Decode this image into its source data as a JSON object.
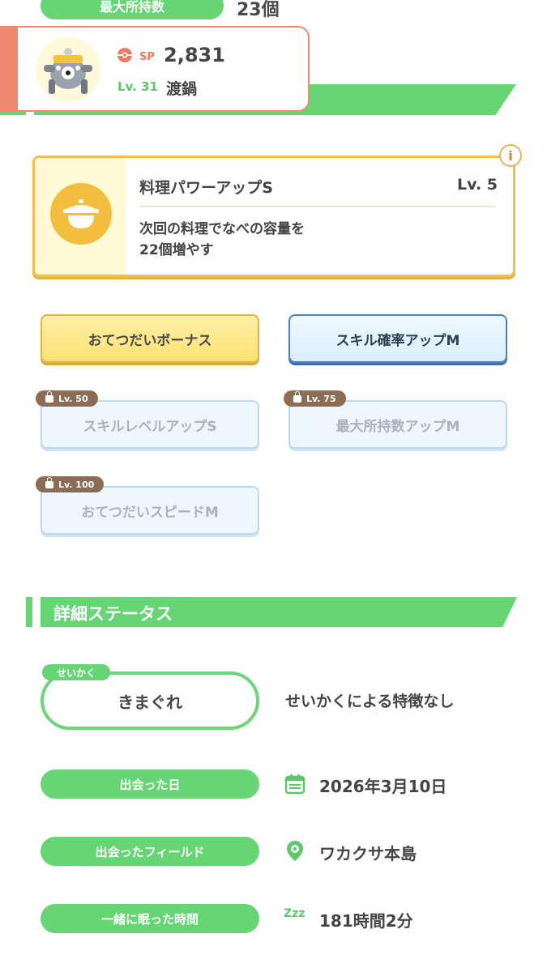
{
  "top_row": {
    "label": "最大所持数",
    "value": "23個"
  },
  "pokemon": {
    "sp_label": "SP",
    "sp_value": "2,831",
    "level": "Lv. 31",
    "name": "渡鍋"
  },
  "main_skill": {
    "title": "料理パワーアップS",
    "level": "Lv. 5",
    "desc_line1": "次回の料理でなべの容量を",
    "desc_line2": "22個増やす",
    "info_icon_text": "i"
  },
  "sub_skills": [
    {
      "label": "おてつだいボーナス",
      "style": "gold",
      "unlocked": true
    },
    {
      "label": "スキル確率アップM",
      "style": "blue",
      "unlocked": true
    },
    {
      "label": "スキルレベルアップS",
      "style": "locked",
      "unlock_level": "Lv. 50"
    },
    {
      "label": "最大所持数アップM",
      "style": "locked",
      "unlock_level": "Lv. 75"
    },
    {
      "label": "おてつだいスピードM",
      "style": "locked",
      "unlock_level": "Lv. 100"
    }
  ],
  "details": {
    "section_title": "詳細ステータス",
    "nature_tag": "せいかく",
    "nature": "きまぐれ",
    "nature_effect": "せいかくによる特徴なし",
    "met_date_label": "出会った日",
    "met_date": "2026年3月10日",
    "met_field_label": "出会ったフィールド",
    "met_field": "ワカクサ本島",
    "sleep_time_label": "一緒に眠った時間",
    "sleep_time": "181時間2分",
    "sleep_icon_text": "Zzz"
  },
  "colors": {
    "green": "#66d674",
    "coral": "#f0886f",
    "gold": "#f2c04a",
    "blue": "#4c7dc6"
  }
}
